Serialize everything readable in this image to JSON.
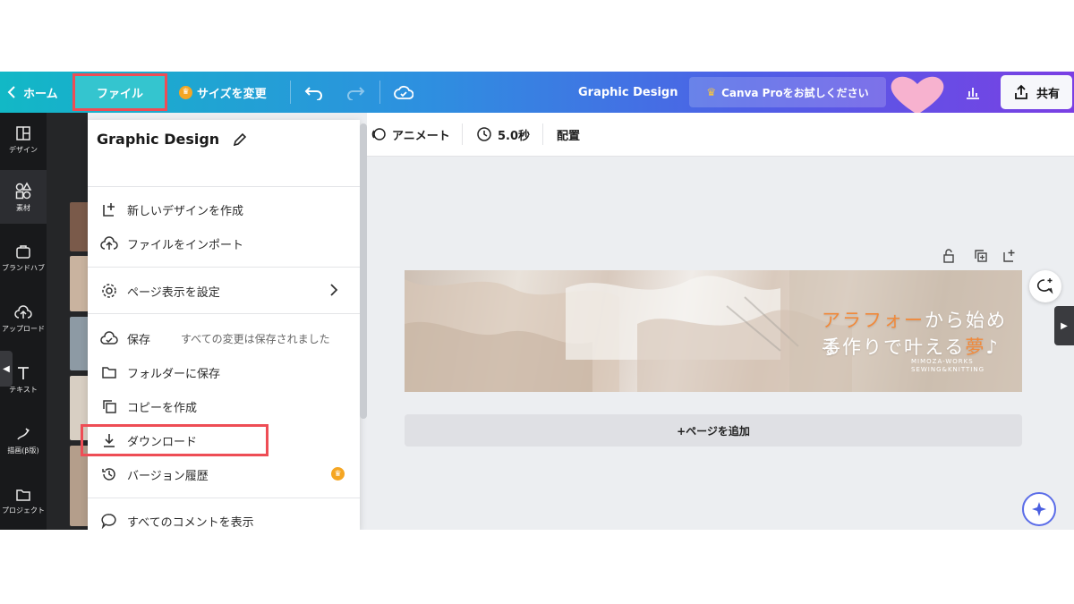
{
  "topbar": {
    "home_label": "ホーム",
    "file_label": "ファイル",
    "resize_label": "サイズを変更",
    "design_title": "Graphic Design",
    "pro_label": "Canva Proをお試しください",
    "share_label": "共有"
  },
  "rail": {
    "items": [
      {
        "label": "デザイン",
        "icon": "layout-icon"
      },
      {
        "label": "素材",
        "icon": "elements-icon"
      },
      {
        "label": "ブランドハブ",
        "icon": "brand-icon"
      },
      {
        "label": "アップロード",
        "icon": "upload-icon"
      },
      {
        "label": "テキスト",
        "icon": "text-icon"
      },
      {
        "label": "描画(β版)",
        "icon": "draw-icon"
      },
      {
        "label": "プロジェクト",
        "icon": "folder-icon"
      }
    ]
  },
  "menu": {
    "title": "Graphic Design",
    "items": {
      "new_design": "新しいデザインを作成",
      "import": "ファイルをインポート",
      "page_settings": "ページ表示を設定",
      "save": "保存",
      "save_status": "すべての変更は保存されました",
      "save_folder": "フォルダーに保存",
      "copy": "コピーを作成",
      "download": "ダウンロード",
      "version": "バージョン履歴",
      "comments": "すべてのコメントを表示"
    }
  },
  "toolbar": {
    "animate_label": "アニメート",
    "duration_label": "5.0秒",
    "position_label": "配置"
  },
  "canvas": {
    "line1_accent": "アラフォー",
    "line1_rest": "から始める",
    "line2_start": "手作りで叶える",
    "line2_accent": "夢",
    "line2_end": "♪",
    "sub1": "MIMOZA-WORKS",
    "sub2": "SEWING&KNITTING",
    "add_page_label": "+ページを追加"
  },
  "colors": {
    "highlight": "#ee4d55",
    "accent_orange": "#f08a3c",
    "heart_pink": "#f7b2cf",
    "crown_gold": "#f5a623"
  }
}
